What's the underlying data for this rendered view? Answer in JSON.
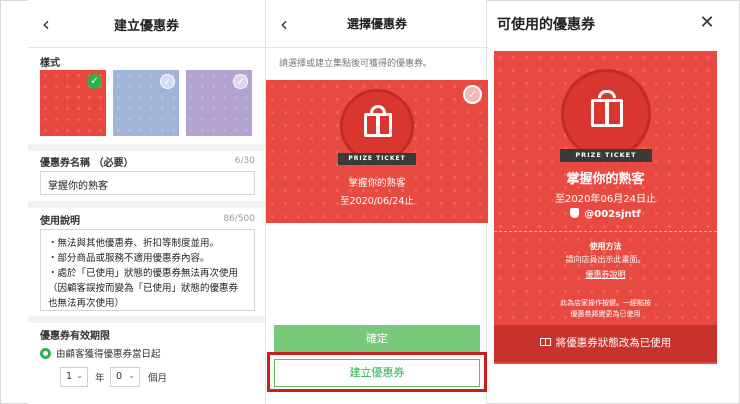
{
  "panel1": {
    "title": "建立優惠券",
    "style_label": "樣式",
    "name_label": "優惠券名稱 （必要）",
    "name_count": "6",
    "name_max": "/30",
    "name_value": "掌握你的熟客",
    "desc_label": "使用說明",
    "desc_count": "86",
    "desc_max": "/500",
    "desc_lines": [
      "・無法與其他優惠券、折扣等制度並用。",
      "・部分商品或服務不適用優惠券內容。",
      "・處於「已使用」狀態的優惠券無法再次使用",
      "（因顧客誤按而變為「已使用」狀態的優惠券",
      "也無法再次使用）"
    ],
    "validity_label": "優惠券有效期限",
    "validity_option": "由顧客獲得優惠券當日起",
    "year_value": "1",
    "year_unit": "年",
    "month_value": "0",
    "month_unit": "個月"
  },
  "panel2": {
    "title": "選擇優惠券",
    "hint": "請選擇或建立集點後可獲得的優惠券。",
    "ticket_ribbon": "PRIZE TICKET",
    "ticket_title": "掌握你的熟客",
    "ticket_expiry": "至2020/06/24止",
    "confirm_label": "確定",
    "create_label": "建立優惠券"
  },
  "panel3": {
    "title": "可使用的優惠券",
    "ribbon": "PRIZE TICKET",
    "coupon_title": "掌握你的熟客",
    "expiry": "至2020年06月24日止",
    "account": "@002sjntf",
    "usage_title": "使用方法",
    "usage_desc": "請向店員出示此畫面。",
    "usage_link": "優惠券說明",
    "note_line1": "此為店家操作按鍵。一經點按",
    "note_line2": "優惠券將變更為已使用",
    "action_label": "將優惠券狀態改為已使用"
  },
  "colors": {
    "coupon_red": "#e84a41",
    "line_green": "#2bb24c",
    "highlight_red": "#c81e1e"
  }
}
